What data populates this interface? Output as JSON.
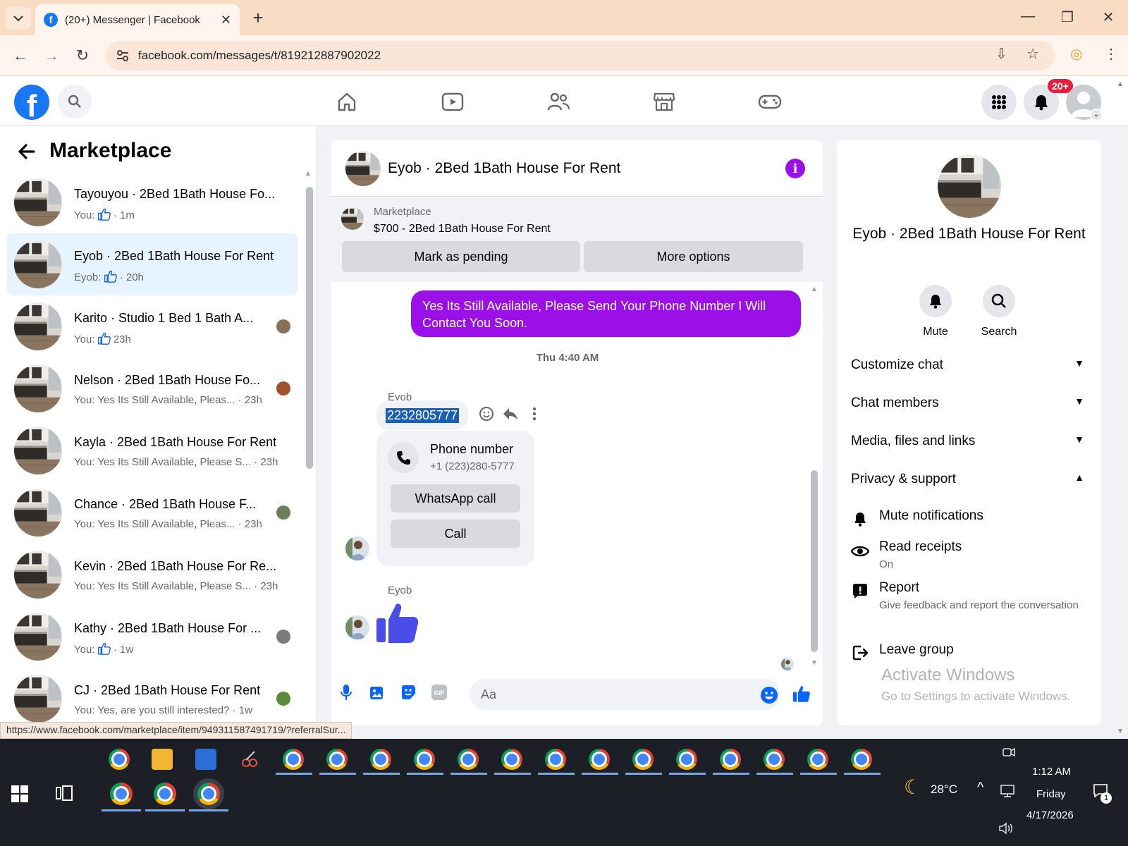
{
  "browser": {
    "tab_title": "(20+) Messenger | Facebook",
    "url": "facebook.com/messages/t/819212887902022",
    "status_url": "https://www.facebook.com/marketplace/item/949311587491719/?referralSur..."
  },
  "topbar": {
    "notification_badge": "20+"
  },
  "sidebar": {
    "title": "Marketplace",
    "conversations": [
      {
        "name": "Tayouyou · 2Bed 1Bath House Fo...",
        "prefix": "You:",
        "liked": true,
        "text": "",
        "time": "· 1m"
      },
      {
        "name": "Eyob · 2Bed 1Bath House For Rent",
        "prefix": "Eyob:",
        "liked": true,
        "text": "",
        "time": "· 20h"
      },
      {
        "name": "Karito · Studio 1 Bed 1 Bath A...",
        "prefix": "You:",
        "liked": true,
        "text": "",
        "time": "23h"
      },
      {
        "name": "Nelson · 2Bed 1Bath House Fo...",
        "prefix": "",
        "liked": false,
        "text": "You: Yes Its Still Available, Pleas...",
        "time": "· 23h"
      },
      {
        "name": "Kayla · 2Bed 1Bath House For Rent",
        "prefix": "",
        "liked": false,
        "text": "You: Yes Its Still Available, Please S...",
        "time": "· 23h"
      },
      {
        "name": "Chance · 2Bed 1Bath House F...",
        "prefix": "",
        "liked": false,
        "text": "You: Yes Its Still Available, Pleas...",
        "time": "· 23h"
      },
      {
        "name": "Kevin · 2Bed 1Bath House For Re...",
        "prefix": "",
        "liked": false,
        "text": "You: Yes Its Still Available, Please S...",
        "time": "· 23h"
      },
      {
        "name": "Kathy · 2Bed 1Bath House For ...",
        "prefix": "You:",
        "liked": true,
        "text": "",
        "time": "· 1w"
      },
      {
        "name": "CJ · 2Bed 1Bath House For Rent",
        "prefix": "",
        "liked": false,
        "text": "You: Yes, are you still interested?",
        "time": "· 1w"
      }
    ]
  },
  "chat": {
    "title": "Eyob · 2Bed 1Bath House For Rent",
    "marketplace_label": "Marketplace",
    "listing": "$700 - 2Bed 1Bath House For Rent",
    "mark_pending": "Mark as pending",
    "more_options": "More options",
    "outgoing_message": "Yes Its Still Available, Please Send Your Phone Number I Will Contact You Soon.",
    "timestamp": "Thu 4:40 AM",
    "sender": "Eyob",
    "incoming_message": "2232805777",
    "phone_card_title": "Phone number",
    "phone_card_number": "+1 (223)280-5777",
    "whatsapp_call": "WhatsApp call",
    "call": "Call",
    "sender2": "Eyob",
    "input_placeholder": "Aa"
  },
  "details": {
    "name": "Eyob · 2Bed 1Bath House For Rent",
    "mute": "Mute",
    "search": "Search",
    "sections": [
      "Customize chat",
      "Chat members",
      "Media, files and links",
      "Privacy & support"
    ],
    "mute_notifications": "Mute notifications",
    "read_receipts": "Read receipts",
    "read_receipts_state": "On",
    "report": "Report",
    "report_desc": "Give feedback and report the conversation",
    "leave_group": "Leave group"
  },
  "watermark": {
    "line1": "Activate Windows",
    "line2": "Go to Settings to activate Windows."
  },
  "taskbar": {
    "temperature": "28°C",
    "time": "1:12 AM",
    "day": "Friday",
    "date": "4/17/2026",
    "notif_count": "1"
  },
  "colors": {
    "accent": "#9b10e6",
    "facebook_blue": "#1877f2",
    "like_blue": "#4a4de8"
  }
}
